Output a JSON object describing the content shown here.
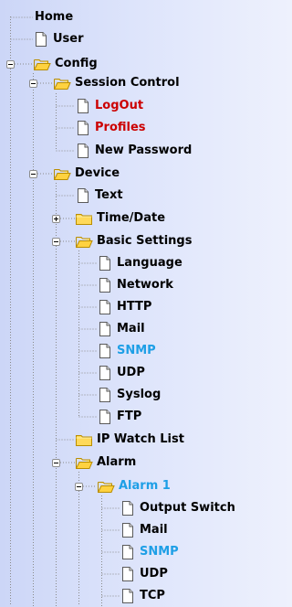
{
  "colors": {
    "normal": "#000000",
    "red": "#cc0000",
    "selected_blue": "#1e9fe6"
  },
  "tree": {
    "items": [
      {
        "id": "home",
        "label": "Home",
        "icon": "none",
        "color": "normal"
      },
      {
        "id": "user",
        "label": "User",
        "icon": "page-icon",
        "color": "normal"
      },
      {
        "id": "config",
        "label": "Config",
        "icon": "folder-open-icon",
        "color": "normal",
        "toggle": "expanded"
      },
      {
        "id": "session-control",
        "label": "Session Control",
        "icon": "folder-open-icon",
        "color": "normal",
        "toggle": "expanded"
      },
      {
        "id": "logout",
        "label": "LogOut",
        "icon": "page-icon",
        "color": "red"
      },
      {
        "id": "profiles",
        "label": "Profiles",
        "icon": "page-icon",
        "color": "red"
      },
      {
        "id": "new-password",
        "label": "New Password",
        "icon": "page-icon",
        "color": "normal"
      },
      {
        "id": "device",
        "label": "Device",
        "icon": "folder-open-icon",
        "color": "normal",
        "toggle": "expanded"
      },
      {
        "id": "text",
        "label": "Text",
        "icon": "page-icon",
        "color": "normal"
      },
      {
        "id": "time-date",
        "label": "Time/Date",
        "icon": "folder-closed-icon",
        "color": "normal",
        "toggle": "collapsed"
      },
      {
        "id": "basic-settings",
        "label": "Basic Settings",
        "icon": "folder-open-icon",
        "color": "normal",
        "toggle": "expanded"
      },
      {
        "id": "language",
        "label": "Language",
        "icon": "page-icon",
        "color": "normal"
      },
      {
        "id": "network",
        "label": "Network",
        "icon": "page-icon",
        "color": "normal"
      },
      {
        "id": "http",
        "label": "HTTP",
        "icon": "page-icon",
        "color": "normal"
      },
      {
        "id": "mail-basic",
        "label": "Mail",
        "icon": "page-icon",
        "color": "normal"
      },
      {
        "id": "snmp-basic",
        "label": "SNMP",
        "icon": "page-icon",
        "color": "selected_blue"
      },
      {
        "id": "udp-basic",
        "label": "UDP",
        "icon": "page-icon",
        "color": "normal"
      },
      {
        "id": "syslog",
        "label": "Syslog",
        "icon": "page-icon",
        "color": "normal"
      },
      {
        "id": "ftp",
        "label": "FTP",
        "icon": "page-icon",
        "color": "normal"
      },
      {
        "id": "ip-watch-list",
        "label": "IP Watch List",
        "icon": "folder-closed-icon",
        "color": "normal"
      },
      {
        "id": "alarm",
        "label": "Alarm",
        "icon": "folder-open-icon",
        "color": "normal",
        "toggle": "expanded"
      },
      {
        "id": "alarm-1",
        "label": "Alarm 1",
        "icon": "folder-open-icon",
        "color": "selected_blue",
        "toggle": "expanded"
      },
      {
        "id": "output-switch",
        "label": "Output Switch",
        "icon": "page-icon",
        "color": "normal"
      },
      {
        "id": "mail-alarm",
        "label": "Mail",
        "icon": "page-icon",
        "color": "normal"
      },
      {
        "id": "snmp-alarm",
        "label": "SNMP",
        "icon": "page-icon",
        "color": "selected_blue"
      },
      {
        "id": "udp-alarm",
        "label": "UDP",
        "icon": "page-icon",
        "color": "normal"
      },
      {
        "id": "tcp",
        "label": "TCP",
        "icon": "page-icon",
        "color": "normal"
      }
    ]
  }
}
